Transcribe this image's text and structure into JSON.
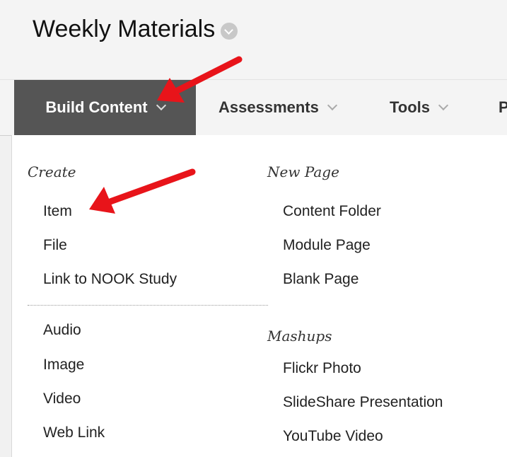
{
  "page": {
    "title": "Weekly Materials"
  },
  "menu": {
    "items": [
      {
        "label": "Build Content"
      },
      {
        "label": "Assessments"
      },
      {
        "label": "Tools"
      },
      {
        "label": "P"
      }
    ]
  },
  "dropdown": {
    "create": {
      "heading": "Create",
      "items": [
        "Item",
        "File",
        "Link to NOOK Study"
      ],
      "items2": [
        "Audio",
        "Image",
        "Video",
        "Web Link"
      ]
    },
    "new_page": {
      "heading": "New Page",
      "items": [
        "Content Folder",
        "Module Page",
        "Blank Page"
      ]
    },
    "mashups": {
      "heading": "Mashups",
      "items": [
        "Flickr Photo",
        "SlideShare Presentation",
        "YouTube Video"
      ]
    }
  },
  "annotations": {
    "arrow_color": "#e8141a"
  }
}
